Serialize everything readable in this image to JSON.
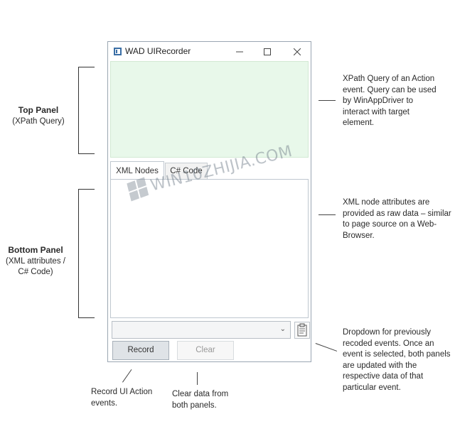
{
  "window": {
    "title": "WAD UIRecorder",
    "minimize_icon": "minimize-icon",
    "maximize_icon": "maximize-icon",
    "close_icon": "close-icon"
  },
  "tabs": [
    {
      "label": "XML Nodes",
      "active": true
    },
    {
      "label": "C# Code",
      "active": false
    }
  ],
  "controls": {
    "dropdown_value": "",
    "record_label": "Record",
    "clear_label": "Clear",
    "clipboard_icon": "clipboard-icon"
  },
  "annotations": {
    "top_panel_title": "Top Panel",
    "top_panel_sub": "(XPath Query)",
    "bottom_panel_title": "Bottom Panel",
    "bottom_panel_sub1": "(XML attributes /",
    "bottom_panel_sub2": "C# Code)",
    "xpath_note": [
      "XPath Query of an Action",
      "event. Query can be used",
      "by WinAppDriver to",
      "interact with target",
      "element."
    ],
    "xml_note": [
      "XML node attributes are",
      "provided as raw data – similar",
      "to page source on a Web-",
      "Browser."
    ],
    "dropdown_note": [
      "Dropdown for previously",
      "recoded events. Once an",
      "event is selected, both panels",
      "are updated with the",
      "respective data of that",
      "particular event."
    ],
    "record_note": [
      "Record UI Action",
      "events."
    ],
    "clear_note": [
      "Clear data from",
      "both panels."
    ]
  },
  "watermark": "WIN10ZHIJIA.COM",
  "colors": {
    "top_panel_bg": "#e8f8ea",
    "window_border": "#9aa6b2"
  }
}
